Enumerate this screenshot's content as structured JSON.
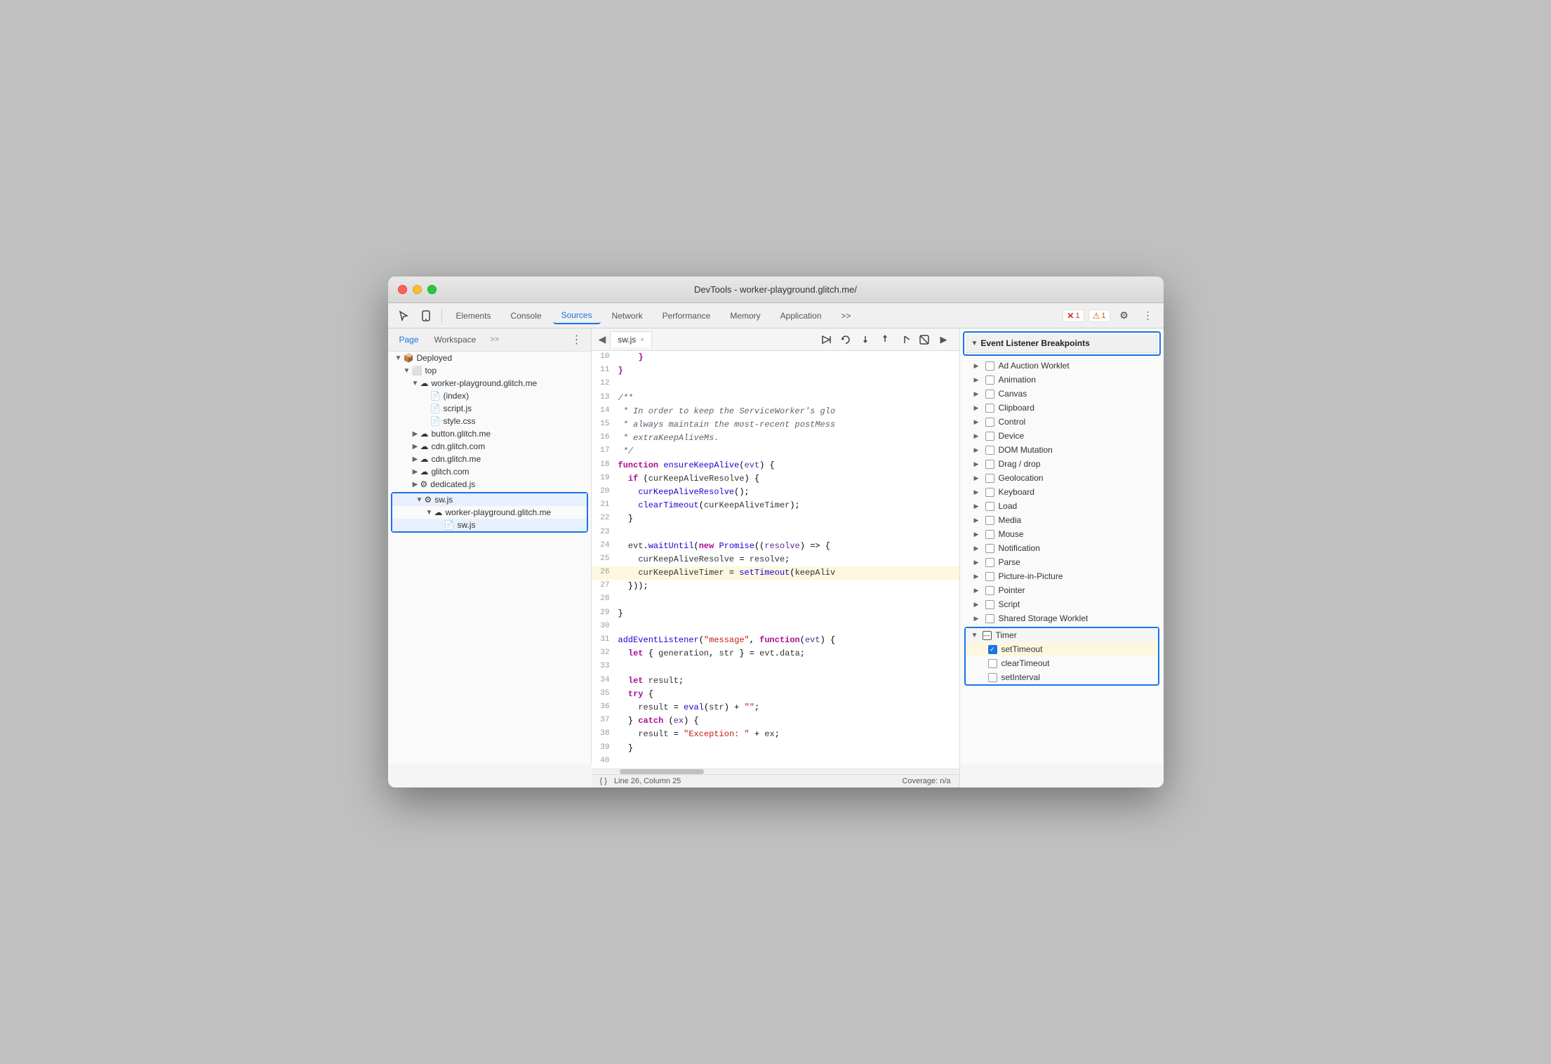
{
  "window": {
    "title": "DevTools - worker-playground.glitch.me/"
  },
  "toolbar": {
    "tabs": [
      "Elements",
      "Console",
      "Sources",
      "Network",
      "Performance",
      "Memory",
      "Application"
    ],
    "active_tab": "Sources",
    "more_tabs": ">>",
    "error_count": "1",
    "warn_count": "1"
  },
  "sidebar": {
    "tabs": [
      "Page",
      "Workspace"
    ],
    "active_tab": "Page",
    "more": ">>",
    "tree": {
      "deployed": "Deployed",
      "top": "top",
      "worker_playground": "worker-playground.glitch.me",
      "index": "(index)",
      "script_js": "script.js",
      "style_css": "style.css",
      "button_glitch": "button.glitch.me",
      "cdn_glitch_com": "cdn.glitch.com",
      "cdn_glitch_me": "cdn.glitch.me",
      "glitch_com": "glitch.com",
      "dedicated_js": "dedicated.js",
      "sw_js_group": "sw.js",
      "worker_playground2": "worker-playground.glitch.me",
      "sw_js_file": "sw.js"
    }
  },
  "code_editor": {
    "tab_name": "sw.js",
    "lines": [
      {
        "num": 10,
        "content": "    }"
      },
      {
        "num": 11,
        "content": "}"
      },
      {
        "num": 12,
        "content": ""
      },
      {
        "num": 13,
        "content": "/**"
      },
      {
        "num": 14,
        "content": " * In order to keep the ServiceWorker's glo"
      },
      {
        "num": 15,
        "content": " * always maintain the most-recent postMess"
      },
      {
        "num": 16,
        "content": " * extraKeepAliveMs."
      },
      {
        "num": 17,
        "content": " */"
      },
      {
        "num": 18,
        "content": "function ensureKeepAlive(evt) {"
      },
      {
        "num": 19,
        "content": "  if (curKeepAliveResolve) {"
      },
      {
        "num": 20,
        "content": "    curKeepAliveResolve();"
      },
      {
        "num": 21,
        "content": "    clearTimeout(curKeepAliveTimer);"
      },
      {
        "num": 22,
        "content": "  }"
      },
      {
        "num": 23,
        "content": ""
      },
      {
        "num": 24,
        "content": "  evt.waitUntil(new Promise((resolve) => {"
      },
      {
        "num": 25,
        "content": "    curKeepAliveResolve = resolve;"
      },
      {
        "num": 26,
        "content": "    curKeepAliveTimer = setTimeout(keepAliv",
        "highlight": true
      },
      {
        "num": 27,
        "content": "  }));"
      },
      {
        "num": 28,
        "content": ""
      },
      {
        "num": 29,
        "content": "}"
      },
      {
        "num": 30,
        "content": ""
      },
      {
        "num": 31,
        "content": "addEventListener(\"message\", function(evt) {"
      },
      {
        "num": 32,
        "content": "  let { generation, str } = evt.data;"
      },
      {
        "num": 33,
        "content": ""
      },
      {
        "num": 34,
        "content": "  let result;"
      },
      {
        "num": 35,
        "content": "  try {"
      },
      {
        "num": 36,
        "content": "    result = eval(str) + \"\";"
      },
      {
        "num": 37,
        "content": "  } catch (ex) {"
      },
      {
        "num": 38,
        "content": "    result = \"Exception: \" + ex;"
      },
      {
        "num": 39,
        "content": "  }"
      },
      {
        "num": 40,
        "content": ""
      }
    ],
    "status_line": "Line 26, Column 25",
    "status_coverage": "Coverage: n/a"
  },
  "breakpoints": {
    "header": "Event Listener Breakpoints",
    "items": [
      {
        "label": "Ad Auction Worklet",
        "checked": false,
        "expandable": true
      },
      {
        "label": "Animation",
        "checked": false,
        "expandable": true
      },
      {
        "label": "Canvas",
        "checked": false,
        "expandable": true
      },
      {
        "label": "Clipboard",
        "checked": false,
        "expandable": true
      },
      {
        "label": "Control",
        "checked": false,
        "expandable": true
      },
      {
        "label": "Device",
        "checked": false,
        "expandable": true
      },
      {
        "label": "DOM Mutation",
        "checked": false,
        "expandable": true
      },
      {
        "label": "Drag / drop",
        "checked": false,
        "expandable": true
      },
      {
        "label": "Geolocation",
        "checked": false,
        "expandable": true
      },
      {
        "label": "Keyboard",
        "checked": false,
        "expandable": true
      },
      {
        "label": "Load",
        "checked": false,
        "expandable": true
      },
      {
        "label": "Media",
        "checked": false,
        "expandable": true
      },
      {
        "label": "Mouse",
        "checked": false,
        "expandable": true
      },
      {
        "label": "Notification",
        "checked": false,
        "expandable": true
      },
      {
        "label": "Parse",
        "checked": false,
        "expandable": true
      },
      {
        "label": "Picture-in-Picture",
        "checked": false,
        "expandable": true
      },
      {
        "label": "Pointer",
        "checked": false,
        "expandable": true
      },
      {
        "label": "Script",
        "checked": false,
        "expandable": true
      },
      {
        "label": "Shared Storage Worklet",
        "checked": false,
        "expandable": true
      }
    ],
    "timer": {
      "label": "Timer",
      "expanded": true,
      "sub_items": [
        {
          "label": "setTimeout",
          "checked": true
        },
        {
          "label": "clearTimeout",
          "checked": false
        },
        {
          "label": "setInterval",
          "checked": false
        }
      ]
    }
  },
  "debugger_controls": {
    "play": "▶",
    "refresh": "↺",
    "step_over": "↓",
    "step_into": "↑",
    "step_out": "→",
    "deactivate": "⊘"
  },
  "icons": {
    "cursor": "⬚",
    "mobile": "□",
    "search": "🔍",
    "gear": "⚙",
    "more": "⋮",
    "error": "✕",
    "warning": "⚠",
    "fold": "{}"
  }
}
